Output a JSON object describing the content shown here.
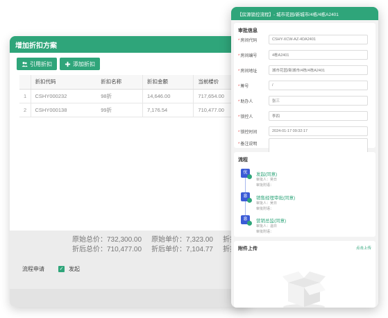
{
  "left_window": {
    "title": "增加折扣方案",
    "buttons": {
      "cite": "引用折扣",
      "add": "添加折扣"
    },
    "table": {
      "headers": [
        "",
        "折扣代码",
        "折扣名称",
        "折扣金额",
        "当前楼价"
      ],
      "rows": [
        [
          "1",
          "CSHY000232",
          "98折",
          "14,646.00",
          "717,654.00"
        ],
        [
          "2",
          "CSHY000138",
          "99折",
          "7,176.54",
          "710,477.00"
        ]
      ]
    },
    "totals": {
      "orig_total": "原始总价：732,300.00",
      "orig_unit": "原始单价：7,323.00",
      "orig_trunc": "折扣",
      "disc_total": "折后总价：710,477.00",
      "disc_unit": "折后单价：7,104.77",
      "disc_trunc": "折扣"
    },
    "flow_label": "流程申请",
    "flow_check_label": "发起"
  },
  "right_window": {
    "title": "【房源锁控流程】- 城市花园/新城市/4栋/4栋A2401",
    "info_section": {
      "title": "审批信息",
      "fields": [
        {
          "label": "房间代码",
          "required": true,
          "value": "CSHY-XCW-AZ-4DA2401"
        },
        {
          "label": "房间编号",
          "required": true,
          "value": "4栋A2401"
        },
        {
          "label": "房间地址",
          "required": true,
          "value": "城市花园/新城市/4栋/4栋A2401"
        },
        {
          "label": "筹号",
          "required": true,
          "value": "/"
        },
        {
          "label": "助办人",
          "required": true,
          "value": "张三"
        },
        {
          "label": "锁控人",
          "required": true,
          "value": "李四"
        },
        {
          "label": "锁控时间",
          "required": true,
          "value": "2024-01-17 09:32:17"
        },
        {
          "label": "备注说明",
          "required": true,
          "value": ""
        }
      ]
    },
    "process_section": {
      "title": "流程",
      "steps": [
        {
          "badge": "优",
          "title": "发起(同意)",
          "approver": "审批人：吴日",
          "note": "审批附语："
        },
        {
          "badge": "息",
          "title": "销售经理审批(同意)",
          "approver": "审批人：吴日",
          "note": "审批附语："
        },
        {
          "badge": "息",
          "title": "营销总监(同意)",
          "approver": "审批人：温日",
          "note": "审批附语："
        }
      ]
    },
    "attach_section": {
      "title": "附件上传",
      "link": "点击上传"
    }
  },
  "colors": {
    "accent": "#2fa57a",
    "step_node": "#3b5bd6",
    "required": "#e05050"
  }
}
